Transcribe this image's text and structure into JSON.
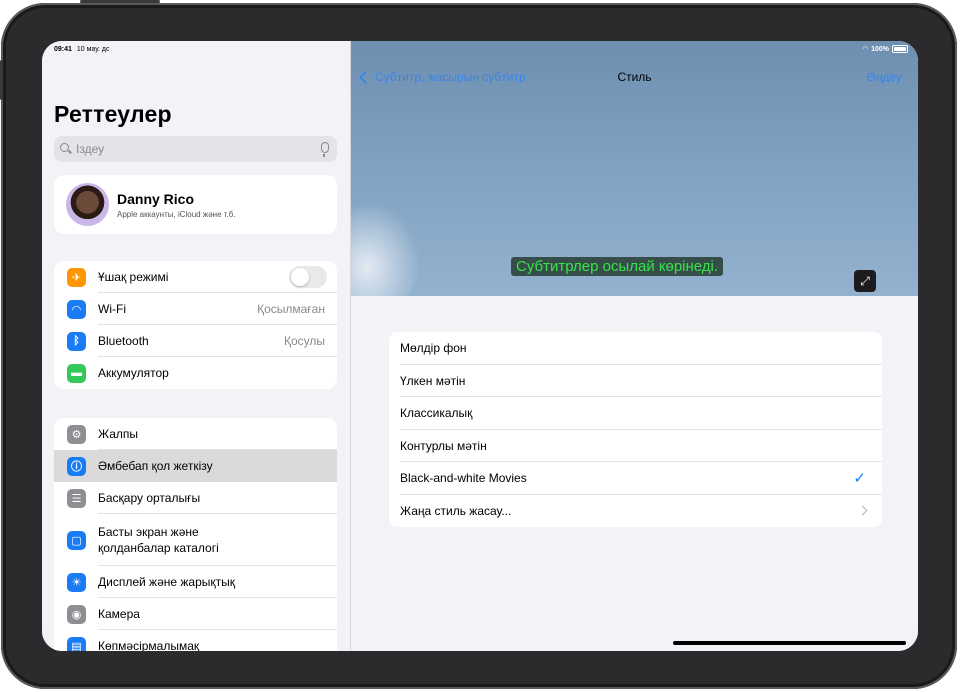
{
  "status": {
    "time": "09:41",
    "date": "10 мау. дс",
    "battery": "100%"
  },
  "sidebar": {
    "title": "Реттеулер",
    "search_placeholder": "Іздеу",
    "profile": {
      "name": "Danny Rico",
      "subtitle": "Apple аккаунты, iCloud және т.б."
    },
    "network": [
      {
        "label": "Ұшақ режимі",
        "icon": "airplane-icon",
        "color": "#ff9500",
        "value": ""
      },
      {
        "label": "Wi-Fi",
        "icon": "wifi-icon",
        "color": "#1a7cf5",
        "value": "Қосылмаған"
      },
      {
        "label": "Bluetooth",
        "icon": "bluetooth-icon",
        "color": "#1a7cf5",
        "value": "Қосулы"
      },
      {
        "label": "Аккумулятор",
        "icon": "battery-icon",
        "color": "#34c759",
        "value": ""
      }
    ],
    "general": [
      {
        "label": "Жалпы",
        "icon": "gear-icon",
        "color": "#8e8e93"
      },
      {
        "label": "Әмбебап қол жеткізу",
        "icon": "accessibility-icon",
        "color": "#1a7cf5"
      },
      {
        "label": "Басқару орталығы",
        "icon": "control-center-icon",
        "color": "#8e8e93"
      },
      {
        "label": "Басты экран және\nқолданбалар каталогі",
        "icon": "home-screen-icon",
        "color": "#1a7cf5"
      },
      {
        "label": "Дисплей және жарықтық",
        "icon": "brightness-icon",
        "color": "#1a7cf5"
      },
      {
        "label": "Камера",
        "icon": "camera-icon",
        "color": "#8e8e93"
      },
      {
        "label": "Көпмәсірмалымақ",
        "icon": "multitasking-icon",
        "color": "#1a7cf5"
      }
    ]
  },
  "detail": {
    "back_label": "Субтитр, жасырын субтитр",
    "title": "Стиль",
    "edit_label": "Өңдеу",
    "sample_text": "Субтитрлер осылай көрінеді.",
    "styles": [
      {
        "label": "Мөлдір фон"
      },
      {
        "label": "Үлкен мәтін"
      },
      {
        "label": "Классикалық"
      },
      {
        "label": "Контурлы мәтін"
      },
      {
        "label": "Black-and-white Movies",
        "checked": true
      },
      {
        "label": "Жаңа стиль жасау...",
        "chevron": true
      }
    ]
  }
}
